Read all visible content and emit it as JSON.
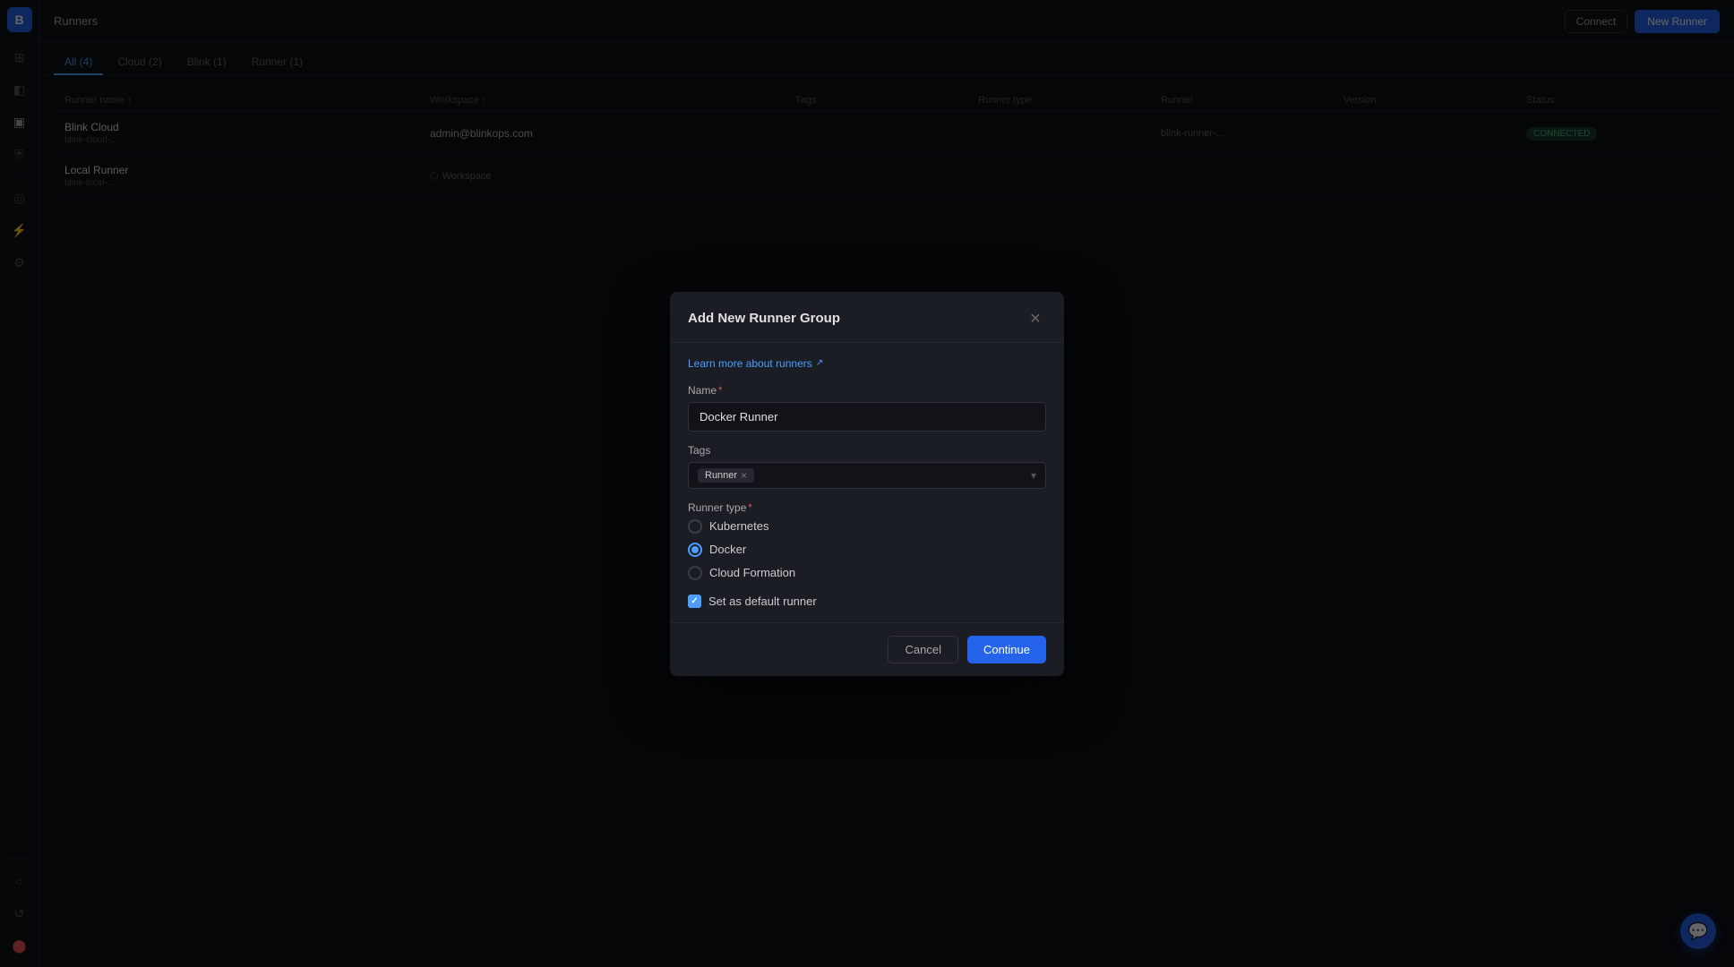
{
  "app": {
    "title": "Runners"
  },
  "sidebar": {
    "items": [
      {
        "id": "logo",
        "icon": "⬡"
      },
      {
        "id": "grid",
        "icon": "⊞"
      },
      {
        "id": "layers",
        "icon": "◫"
      },
      {
        "id": "settings",
        "icon": "⚙"
      },
      {
        "id": "shield",
        "icon": "⛨"
      },
      {
        "id": "monitor",
        "icon": "▣"
      },
      {
        "id": "bolt",
        "icon": "⚡"
      },
      {
        "id": "gear2",
        "icon": "◎"
      },
      {
        "id": "circle",
        "icon": "○"
      },
      {
        "id": "refresh",
        "icon": "↺"
      }
    ]
  },
  "topbar": {
    "title": "Runners",
    "connect_label": "Connect",
    "new_runner_label": "New Runner"
  },
  "tabs": [
    {
      "id": "all",
      "label": "All (4)",
      "active": true
    },
    {
      "id": "cloud",
      "label": "Cloud (2)"
    },
    {
      "id": "blink",
      "label": "Blink (1)"
    },
    {
      "id": "runner",
      "label": "Runner (1)"
    }
  ],
  "table": {
    "headers": [
      "Runner name ↑",
      "Workspace ↑",
      "Tags",
      "Runner type",
      "Runner",
      "Version",
      "Status"
    ],
    "rows": [
      {
        "name": "Blink Cloud",
        "sub_name": "blink-cloud-...",
        "workspace": "admin@blinkops.com",
        "workspace_sub": "",
        "tags": "",
        "runner_type": "",
        "runner": "blink-runner-...",
        "version": "",
        "status": "CONNECTED",
        "status_type": "green"
      },
      {
        "name": "Local Runner",
        "sub_name": "blink-local-...",
        "workspace": "Workspace",
        "workspace_sub": "",
        "tags": "",
        "runner_type": "",
        "runner": "",
        "version": "",
        "status": "",
        "status_type": "gray"
      }
    ]
  },
  "modal": {
    "title": "Add New Runner Group",
    "learn_more_text": "Learn more about runners",
    "name_label": "Name",
    "name_placeholder": "Docker Runner",
    "name_value": "Docker Runner",
    "tags_label": "Tags",
    "tag_chip": "Runner",
    "runner_type_label": "Runner type",
    "runner_options": [
      {
        "id": "kubernetes",
        "label": "Kubernetes",
        "checked": false
      },
      {
        "id": "docker",
        "label": "Docker",
        "checked": true
      },
      {
        "id": "cloudformation",
        "label": "Cloud Formation",
        "checked": false
      }
    ],
    "default_runner_label": "Set as default runner",
    "default_runner_checked": true,
    "cancel_label": "Cancel",
    "continue_label": "Continue"
  },
  "chat_icon": "💬"
}
